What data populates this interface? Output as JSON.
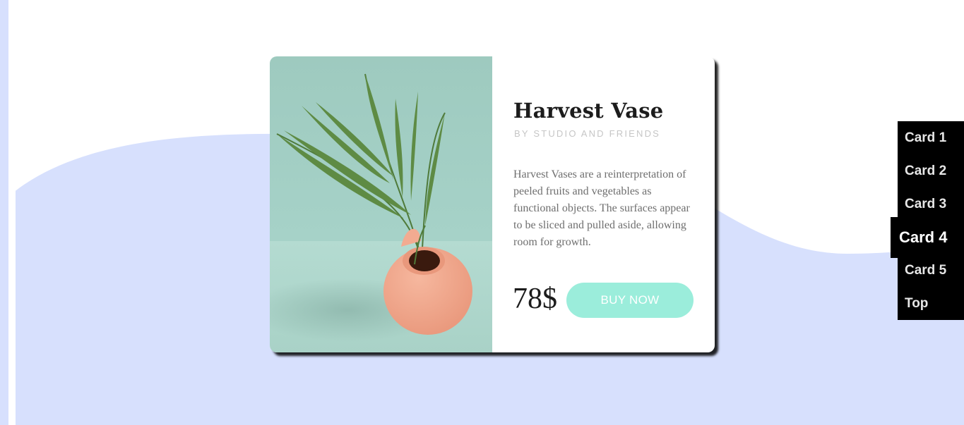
{
  "colors": {
    "background": "#ffffff",
    "wave": "#d7e0fd",
    "card_bg": "#ffffff",
    "accent_button": "#9beddb",
    "nav_bg": "#000000"
  },
  "product": {
    "title": "Harvest Vase",
    "subtitle": "by Studio and Friends",
    "description": "Harvest Vases are a reinterpretation of peeled fruits and vegetables as functional objects. The surfaces appear to be sliced and pulled aside, allowing room for growth.",
    "price": "78$",
    "buy_label": "Buy now",
    "image_icon": "vase-with-palm-leaves-photo"
  },
  "nav": {
    "items": [
      {
        "label": "Card 1",
        "active": false
      },
      {
        "label": "Card 2",
        "active": false
      },
      {
        "label": "Card 3",
        "active": false
      },
      {
        "label": "Card 4",
        "active": true
      },
      {
        "label": "Card 5",
        "active": false
      },
      {
        "label": "Top",
        "active": false
      }
    ]
  }
}
